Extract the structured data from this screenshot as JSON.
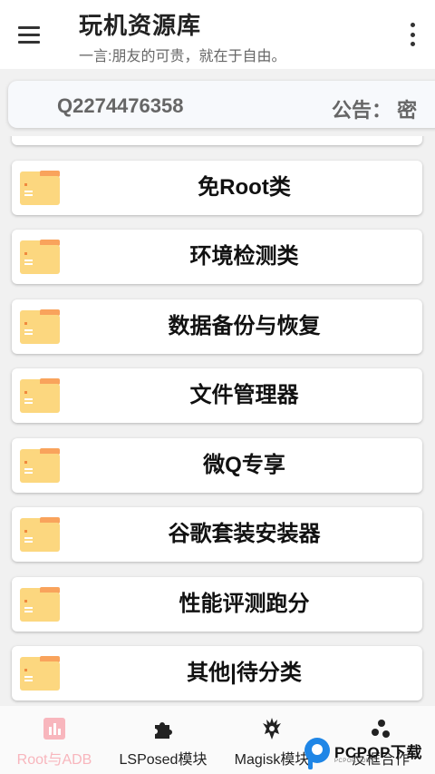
{
  "header": {
    "title": "玩机资源库",
    "subtitle": "一言:朋友的可贵，就在于自由。",
    "menu_icon": "hamburger-menu-icon",
    "more_icon": "more-vertical-icon"
  },
  "notice": {
    "text": "Q2274476358",
    "label": "公告： 密"
  },
  "categories": [
    {
      "label": "免Root类",
      "icon": "folder-icon"
    },
    {
      "label": "环境检测类",
      "icon": "folder-icon"
    },
    {
      "label": "数据备份与恢复",
      "icon": "folder-icon"
    },
    {
      "label": "文件管理器",
      "icon": "folder-icon"
    },
    {
      "label": "微Q专享",
      "icon": "folder-icon"
    },
    {
      "label": "谷歌套装安装器",
      "icon": "folder-icon"
    },
    {
      "label": "性能评测跑分",
      "icon": "folder-icon"
    },
    {
      "label": "其他|待分类",
      "icon": "folder-icon"
    }
  ],
  "bottom_nav": [
    {
      "label": "Root与ADB",
      "icon": "bar-chart-icon",
      "active": true
    },
    {
      "label": "LSPosed模块",
      "icon": "puzzle-icon",
      "active": false
    },
    {
      "label": "Magisk模块",
      "icon": "magisk-mask-icon",
      "active": false
    },
    {
      "label": "反框合作",
      "icon": "molecule-icon",
      "active": false
    }
  ],
  "watermark": {
    "text": "PCPOP下载",
    "sub": "PCPOP.COM"
  },
  "colors": {
    "active_nav": "#f8b6bd",
    "folder_body": "#fcd77f",
    "folder_tab": "#f9a35c",
    "watermark_blue": "#1f86e6"
  }
}
